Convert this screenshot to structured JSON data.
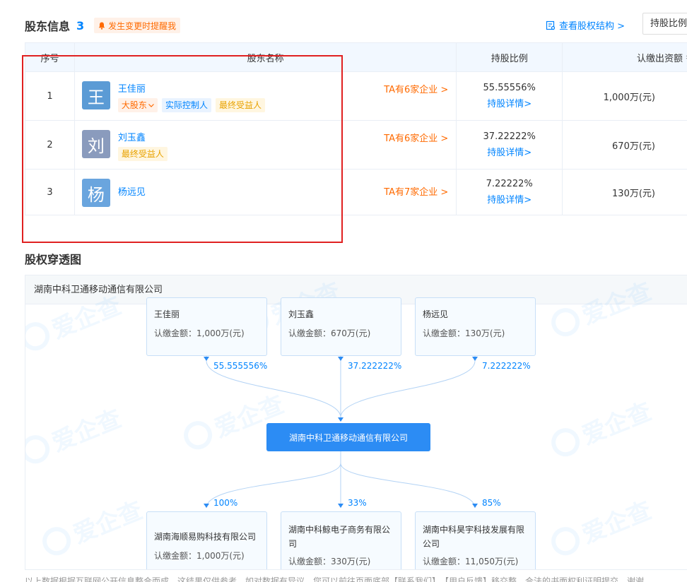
{
  "header": {
    "title": "股东信息",
    "count": "3",
    "alert_label": "发生变更时提醒我",
    "equity_link": "查看股权结构 >",
    "sort_value": "持股比例"
  },
  "table": {
    "columns": [
      "序号",
      "股东名称",
      "持股比例",
      "认缴出资额"
    ],
    "rows": [
      {
        "index": "1",
        "avatar": "王",
        "avatar_color": "#5b9bd5",
        "name": "王佳丽",
        "tags": [
          "大股东",
          "实际控制人",
          "最终受益人"
        ],
        "ta": "TA有6家企业 >",
        "ratio": "55.55556%",
        "detail": "持股详情>",
        "amount": "1,000万(元)"
      },
      {
        "index": "2",
        "avatar": "刘",
        "avatar_color": "#8a9bbd",
        "name": "刘玉鑫",
        "tags": [
          "最终受益人"
        ],
        "ta": "TA有6家企业 >",
        "ratio": "37.22222%",
        "detail": "持股详情>",
        "amount": "670万(元)"
      },
      {
        "index": "3",
        "avatar": "杨",
        "avatar_color": "#6aa5de",
        "name": "杨远见",
        "tags": [],
        "ta": "TA有7家企业 >",
        "ratio": "7.22222%",
        "detail": "持股详情>",
        "amount": "130万(元)"
      }
    ]
  },
  "penetration": {
    "title": "股权穿透图",
    "company": "湖南中科卫通移动通信有限公司",
    "watermark": "爱企查",
    "shareholders": [
      {
        "name": "王佳丽",
        "amount": "认缴金额：1,000万(元)",
        "pct": "55.555556%"
      },
      {
        "name": "刘玉鑫",
        "amount": "认缴金额：670万(元)",
        "pct": "37.222222%"
      },
      {
        "name": "杨远见",
        "amount": "认缴金额：130万(元)",
        "pct": "7.222222%"
      }
    ],
    "center": "湖南中科卫通移动通信有限公司",
    "investments": [
      {
        "name": "湖南海顺易购科技有限公司",
        "amount": "认缴金额：1,000万(元)",
        "pct": "100%"
      },
      {
        "name": "湖南中科鲸电子商务有限公司",
        "amount": "认缴金额：330万(元)",
        "pct": "33%"
      },
      {
        "name": "湖南中科昊宇科技发展有限公司",
        "amount": "认缴金额：11,050万(元)",
        "pct": "85%"
      }
    ]
  },
  "footnote": "以上数据根据互联网公开信息整合而成，这结果仅供参考，如对数据有异议，您可以前往页面底部【联系我们】、【用户反馈】移交整，合法的书面权利证明提交，谢谢"
}
